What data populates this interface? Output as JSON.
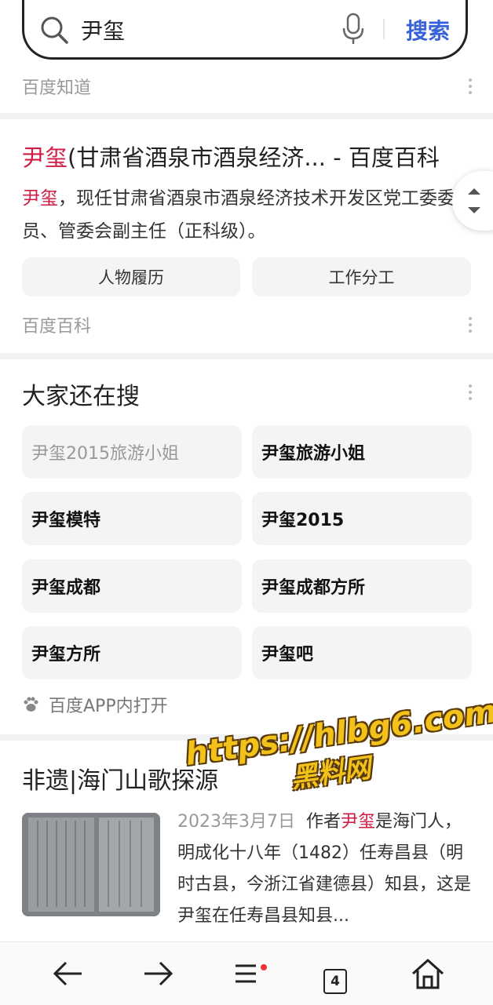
{
  "search": {
    "query": "尹玺",
    "button_label": "搜索"
  },
  "zhidao": {
    "source": "百度知道"
  },
  "baike": {
    "title_hl": "尹玺",
    "title_rest": "(甘肃省酒泉市酒泉经济... - 百度百科",
    "abstract_hl": "尹玺",
    "abstract_rest": "，现任甘肃省酒泉市酒泉经济技术开发区党工委委员、管委会副主任（正科级）。",
    "chips": [
      "人物履历",
      "工作分工"
    ],
    "source": "百度百科"
  },
  "related": {
    "title": "大家还在搜",
    "items": [
      "尹玺2015旅游小姐",
      "尹玺旅游小姐",
      "尹玺模特",
      "尹玺2015",
      "尹玺成都",
      "尹玺成都方所",
      "尹玺方所",
      "尹玺吧"
    ],
    "open_app": "百度APP内打开"
  },
  "article": {
    "title": "非遗|海门山歌探源",
    "date": "2023年3月7日",
    "pre": "作者",
    "hl": "尹玺",
    "rest": "是海门人，明成化十八年（1482）任寿昌县（明时古县，今浙江省建德县）知县，这是尹玺在任寿昌县知县..."
  },
  "watermark": {
    "line1": "https://hlbg6.com",
    "line2": "黑料网"
  },
  "bottom": {
    "tab_count": "4"
  },
  "colors": {
    "accent": "#3a62d8",
    "highlight": "#cd1d45"
  }
}
